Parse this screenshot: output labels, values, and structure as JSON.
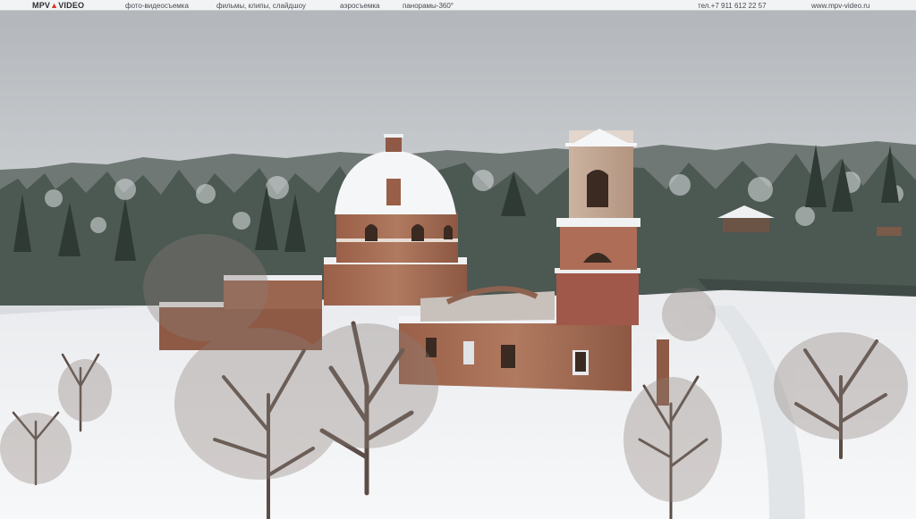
{
  "topbar": {
    "logo_left": "MPV",
    "logo_accent": "▲",
    "logo_right": "VIDEO",
    "links": [
      "фото-видеосъемка",
      "фильмы, клипы, слайдшоу",
      "аэросъемка",
      "панорамы-360°"
    ],
    "phone": "тел.+7 911 612 22 57",
    "website": "www.mpv-video.ru"
  },
  "colors": {
    "sky": "#b9bdc1",
    "snow": "#f4f5f7",
    "brick": "#a0694f",
    "forest": "#3d4a44",
    "accent": "#d8342a"
  }
}
